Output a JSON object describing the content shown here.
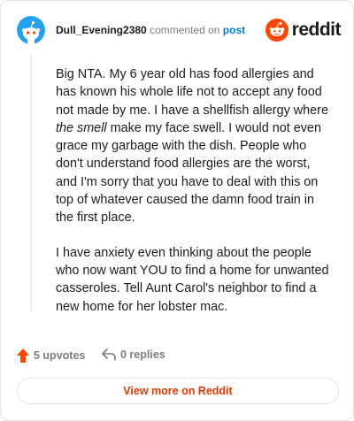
{
  "header": {
    "username": "Dull_Evening2380",
    "action_text": "commented on",
    "post_link": "post",
    "brand": "reddit"
  },
  "comment": {
    "paragraph1": {
      "part1": "Big NTA. My 6 year old has food allergies and has known his whole life not to accept any food not made by me. I have a shellfish allergy where ",
      "emphasis": "the smell",
      "part2": " make my face swell. I would not even grace my garbage with the dish. People who don't understand food allergies are the worst, and I'm sorry that you have to deal with this on top of whatever caused the damn food train in the first place."
    },
    "paragraph2": "I have anxiety even thinking about the people who now want YOU to find a home for unwanted casseroles. Tell Aunt Carol's neighbor to find a new home for her lobster mac."
  },
  "footer": {
    "upvotes": "5 upvotes",
    "replies": "0 replies",
    "view_more": "View more on Reddit"
  },
  "colors": {
    "brand_orange": "#ff4500",
    "link_blue": "#0079d3",
    "button_text": "#d93a00",
    "avatar_bg": "#24a0ed"
  },
  "icons": {
    "avatar": "snoo-avatar-icon",
    "logo": "reddit-logo-icon",
    "upvote": "upvote-arrow-icon",
    "reply": "reply-arrow-icon"
  }
}
